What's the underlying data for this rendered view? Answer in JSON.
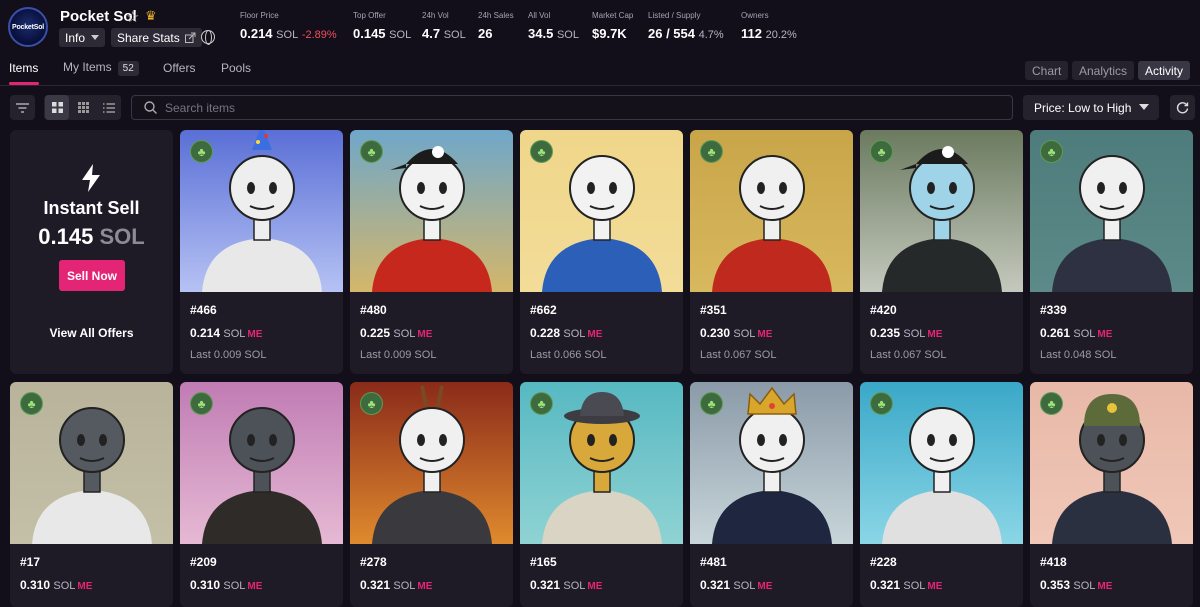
{
  "collection": {
    "logo_text": "PocketSol",
    "name": "Pocket Sol",
    "info_label": "Info",
    "share_label": "Share Stats"
  },
  "stats": [
    {
      "label": "Floor Price",
      "value": "0.214",
      "unit": "SOL",
      "change": "-2.89%"
    },
    {
      "label": "Top Offer",
      "value": "0.145",
      "unit": "SOL"
    },
    {
      "label": "24h Vol",
      "value": "4.7",
      "unit": "SOL"
    },
    {
      "label": "24h Sales",
      "value": "26"
    },
    {
      "label": "All Vol",
      "value": "34.5",
      "unit": "SOL"
    },
    {
      "label": "Market Cap",
      "value": "$9.7K"
    },
    {
      "label": "Listed / Supply",
      "value": "26 / 554",
      "unit": "4.7%"
    },
    {
      "label": "Owners",
      "value": "112",
      "unit": "20.2%"
    }
  ],
  "tabs": {
    "items": "Items",
    "my_items": "My Items",
    "my_items_count": "52",
    "offers": "Offers",
    "pools": "Pools"
  },
  "view_tabs": [
    "Chart",
    "Analytics",
    "Activity"
  ],
  "toolbar": {
    "search_placeholder": "Search items",
    "sort_label": "Price: Low to High"
  },
  "instant_sell": {
    "title": "Instant Sell",
    "price": "0.145",
    "unit": "SOL",
    "button": "Sell Now",
    "view_all": "View All Offers"
  },
  "nfts": [
    {
      "name": "#466",
      "price": "0.214",
      "last": "Last 0.009 SOL",
      "bg": "#5a6fd6",
      "bg2": "#b6c2f4",
      "head": "#eeeeee",
      "shirt": "#e8e8e8",
      "hat": "party"
    },
    {
      "name": "#480",
      "price": "0.225",
      "last": "Last 0.009 SOL",
      "bg": "#6fa7c9",
      "bg2": "#d4b66a",
      "head": "#f2f2f2",
      "shirt": "#c7281e",
      "hat": "cap"
    },
    {
      "name": "#662",
      "price": "0.228",
      "last": "Last 0.066 SOL",
      "bg": "#f0d68a",
      "bg2": "#f2dc98",
      "head": "#f2f2f2",
      "shirt": "#2b5fb8",
      "hat": ""
    },
    {
      "name": "#351",
      "price": "0.230",
      "last": "Last 0.067 SOL",
      "bg": "#c9a549",
      "bg2": "#d8b85e",
      "head": "#f0f0f0",
      "shirt": "#c02a1e",
      "hat": ""
    },
    {
      "name": "#420",
      "price": "0.235",
      "last": "Last 0.067 SOL",
      "bg": "#6b7a5f",
      "bg2": "#c4c9bd",
      "head": "#9fd3e8",
      "shirt": "#26292a",
      "hat": "cap"
    },
    {
      "name": "#339",
      "price": "0.261",
      "last": "Last 0.048 SOL",
      "bg": "#4e7c7c",
      "bg2": "#5c8a88",
      "head": "#f0f0f0",
      "shirt": "#2e3142",
      "hat": ""
    },
    {
      "name": "#17",
      "price": "0.310",
      "last": "",
      "bg": "#b8b39a",
      "bg2": "#c4c0a8",
      "head": "#555a60",
      "shirt": "#e8e8e8",
      "hat": ""
    },
    {
      "name": "#209",
      "price": "0.310",
      "last": "",
      "bg": "#c07cb4",
      "bg2": "#e6b9d4",
      "head": "#4d5258",
      "shirt": "#2e2b28",
      "hat": ""
    },
    {
      "name": "#278",
      "price": "0.321",
      "last": "",
      "bg": "#8a2a1a",
      "bg2": "#e08a2e",
      "head": "#f0f0f0",
      "shirt": "#3a3a3e",
      "hat": "sticks"
    },
    {
      "name": "#165",
      "price": "0.321",
      "last": "",
      "bg": "#57b8c2",
      "bg2": "#8fd3d3",
      "head": "#d8a83a",
      "shirt": "#d9d4c4",
      "hat": "fedora"
    },
    {
      "name": "#481",
      "price": "0.321",
      "last": "",
      "bg": "#8a9aa8",
      "bg2": "#c8d6da",
      "head": "#f0f0f0",
      "shirt": "#1f2740",
      "hat": "crown"
    },
    {
      "name": "#228",
      "price": "0.321",
      "last": "",
      "bg": "#3aa8c8",
      "bg2": "#8ad6e6",
      "head": "#f0f0f0",
      "shirt": "#e0e0e0",
      "hat": ""
    },
    {
      "name": "#418",
      "price": "0.353",
      "last": "",
      "bg": "#e8b8a8",
      "bg2": "#f0c8b8",
      "head": "#4d5258",
      "shirt": "#2b3040",
      "hat": "helmet"
    }
  ],
  "price_unit": "SOL",
  "me_mark": "ME",
  "colors": {
    "accent": "#e42575",
    "negative": "#ef4d5c",
    "background": "#120f1a"
  }
}
